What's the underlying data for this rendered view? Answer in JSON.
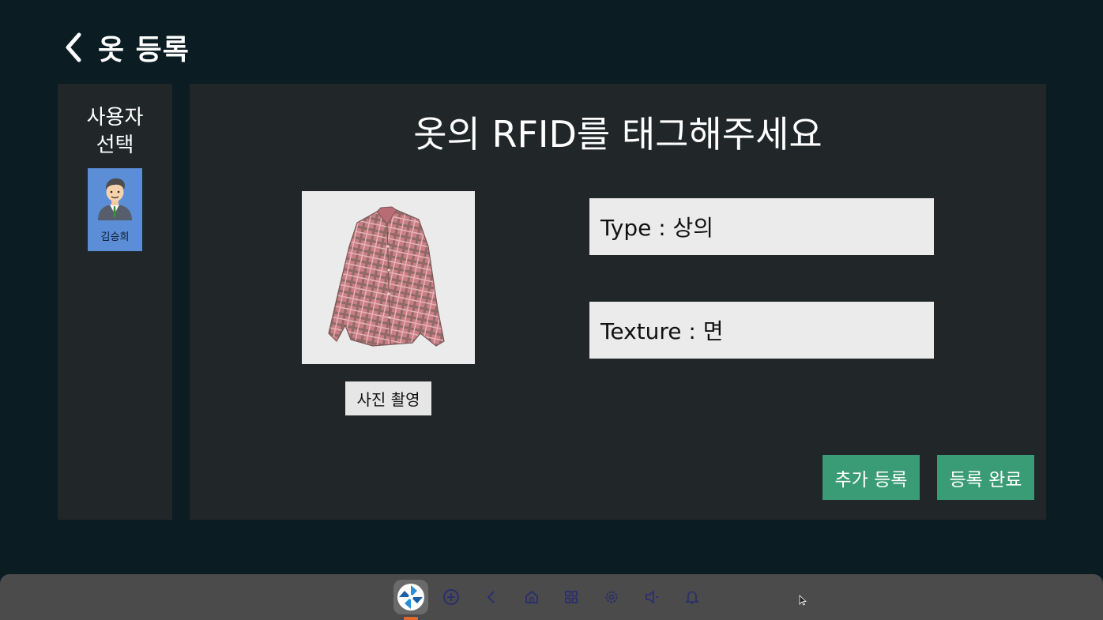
{
  "header": {
    "title": "옷 등록",
    "back_icon": "chevron-left-icon"
  },
  "sidebar": {
    "title_line1": "사용자",
    "title_line2": "선택",
    "user": {
      "name": "김승희",
      "avatar_icon": "person-avatar-icon"
    }
  },
  "main": {
    "instruction": "옷의 RFID를 태그해주세요",
    "photo": {
      "image_icon": "plaid-shirt-image",
      "button_label": "사진 촬영"
    },
    "type_field": "Type : 상의",
    "texture_field": "Texture : 면",
    "add_button_label": "추가 등록",
    "done_button_label": "등록 완료",
    "accent_color": "#3a9b77"
  },
  "taskbar": {
    "icons": [
      "app-pinwheel-icon",
      "add-circle-icon",
      "back-icon",
      "home-icon",
      "apps-grid-icon",
      "settings-icon",
      "volume-icon",
      "notification-bell-icon"
    ]
  }
}
